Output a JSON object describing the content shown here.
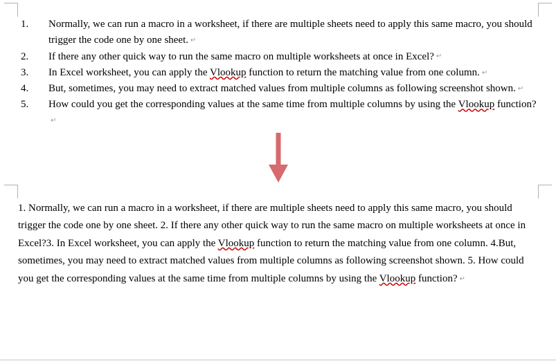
{
  "list": {
    "items": [
      {
        "num": "1.",
        "text_a": "Normally, we can run a macro in a worksheet, if there are multiple sheets need to apply this same macro, you should trigger the code one by one sheet."
      },
      {
        "num": "2.",
        "text_a": "If there any other quick way to run the same macro on multiple worksheets at once in Excel?"
      },
      {
        "num": "3.",
        "text_a": "In Excel worksheet, you can apply the ",
        "wavy": "Vlookup",
        "text_b": " function to return the matching value from one column."
      },
      {
        "num": "4.",
        "text_a": "But, sometimes, you may need to extract matched values from multiple columns as following screenshot shown."
      },
      {
        "num": "5.",
        "text_a": "How could you get the corresponding values at the same time from multiple columns by using the ",
        "wavy": "Vlookup",
        "text_b": " function?"
      }
    ]
  },
  "paragraph": {
    "seg1": "1.    Normally, we can run a macro in a worksheet, if there are multiple sheets need to apply this same macro, you should trigger the code one by one sheet. 2.   If there any other quick way to run the same macro on multiple worksheets at once in Excel?3.  In Excel worksheet, you can apply the ",
    "wavy1": "Vlookup",
    "seg2": " function to return the matching value from one column. 4.But, sometimes, you may need to extract matched values from multiple columns as following screenshot shown. 5.    How could you get the corresponding values at the same time from multiple columns by using the ",
    "wavy2": "Vlookup",
    "seg3": " function?"
  },
  "arrow": {
    "color": "#d66a6e"
  },
  "pmark": "↵"
}
